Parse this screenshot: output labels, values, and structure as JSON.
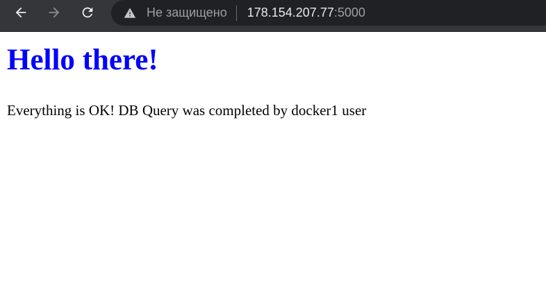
{
  "browser": {
    "nav": {
      "back_icon": "arrow-left-icon",
      "forward_icon": "arrow-right-icon",
      "reload_icon": "reload-icon"
    },
    "address_bar": {
      "security_icon": "warning-triangle-icon",
      "security_text": "Не защищено",
      "url_host": "178.154.207.77",
      "url_port": ":5000"
    },
    "colors": {
      "toolbar_bg": "#35363a",
      "omnibox_bg": "#202124",
      "url_text": "#e8eaed",
      "muted_text": "#9aa0a6"
    }
  },
  "page": {
    "heading": "Hello there!",
    "message": "Everything is OK! DB Query was completed by docker1 user",
    "colors": {
      "heading": "#0000ff",
      "text": "#000000",
      "background": "#ffffff"
    }
  }
}
